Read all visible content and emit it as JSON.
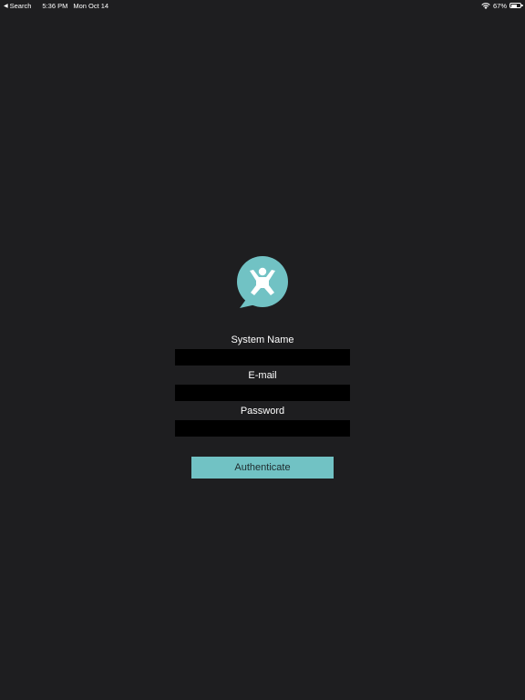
{
  "status_bar": {
    "back_label": "Search",
    "time": "5:36 PM",
    "date": "Mon Oct 14",
    "battery_text": "67%",
    "battery_level": 0.67
  },
  "form": {
    "system_name_label": "System Name",
    "system_name_value": "",
    "email_label": "E-mail",
    "email_value": "",
    "password_label": "Password",
    "password_value": "",
    "submit_label": "Authenticate"
  },
  "colors": {
    "background": "#1e1e20",
    "accent": "#71c2c4",
    "input_background": "#000000"
  }
}
